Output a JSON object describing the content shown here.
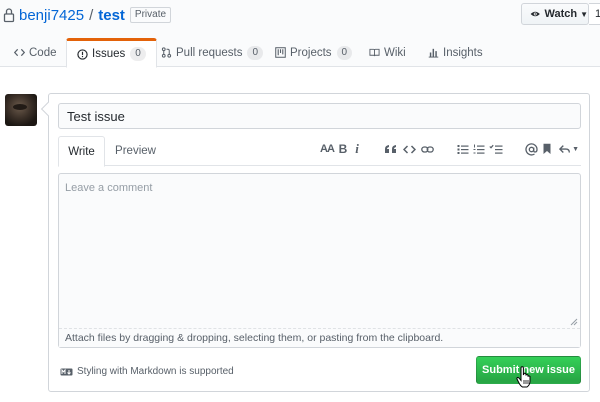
{
  "repo": {
    "owner": "benji7425",
    "separator": "/",
    "name": "test",
    "visibility": "Private"
  },
  "actions": {
    "watch_label": "Watch",
    "watch_count": "1"
  },
  "tabs": [
    {
      "label": "Code",
      "icon": "code-icon"
    },
    {
      "label": "Issues",
      "count": "0",
      "icon": "issue-icon",
      "selected": true
    },
    {
      "label": "Pull requests",
      "count": "0",
      "icon": "pull-request-icon"
    },
    {
      "label": "Projects",
      "count": "0",
      "icon": "project-icon"
    },
    {
      "label": "Wiki",
      "icon": "book-icon"
    },
    {
      "label": "Insights",
      "icon": "graph-icon"
    }
  ],
  "form": {
    "title_value": "Test issue",
    "write_tab": "Write",
    "preview_tab": "Preview",
    "comment_placeholder": "Leave a comment",
    "attach_hint": "Attach files by dragging & dropping, selecting them, or pasting from the clipboard.",
    "markdown_note": "Styling with Markdown is supported",
    "submit_label": "Submit new issue"
  },
  "toolbar": {
    "heading": "AA",
    "bold": "B",
    "italic": "i"
  },
  "colors": {
    "link": "#0366d6",
    "selected_tab_accent": "#e36209",
    "submit_green": "#28a745"
  }
}
